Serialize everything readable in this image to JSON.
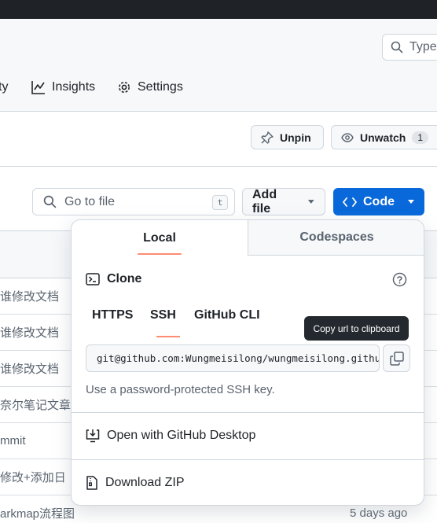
{
  "header": {
    "search_placeholder": "Type",
    "nav": {
      "fragment": "ty",
      "insights": "Insights",
      "settings": "Settings"
    }
  },
  "actions": {
    "unpin": "Unpin",
    "unwatch": "Unwatch",
    "watch_count": "1"
  },
  "toolbar": {
    "goto_placeholder": "Go to file",
    "goto_shortcut": "t",
    "add_file": "Add file",
    "code": "Code"
  },
  "files": [
    {
      "msg": "谁修改文档",
      "time": ""
    },
    {
      "msg": "谁修改文档",
      "time": ""
    },
    {
      "msg": "谁修改文档",
      "time": ""
    },
    {
      "msg": "奈尔笔记文章",
      "time": ""
    },
    {
      "msg": "mmit",
      "time": ""
    },
    {
      "msg": "修改+添加日",
      "time": ""
    },
    {
      "msg": "arkmap流程图",
      "time": "5 days ago"
    }
  ],
  "popover": {
    "tab_local": "Local",
    "tab_codespaces": "Codespaces",
    "clone_title": "Clone",
    "subtabs": {
      "https": "HTTPS",
      "ssh": "SSH",
      "cli": "GitHub CLI"
    },
    "url": "git@github.com:Wungmeisilong/wungmeisilong.github.io.git",
    "hint": "Use a password-protected SSH key.",
    "open_desktop": "Open with GitHub Desktop",
    "download_zip": "Download ZIP"
  },
  "tooltip": "Copy url to clipboard",
  "colors": {
    "accent": "#0969da",
    "tab_underline": "#fd8c73",
    "topbar": "#1f2328"
  }
}
